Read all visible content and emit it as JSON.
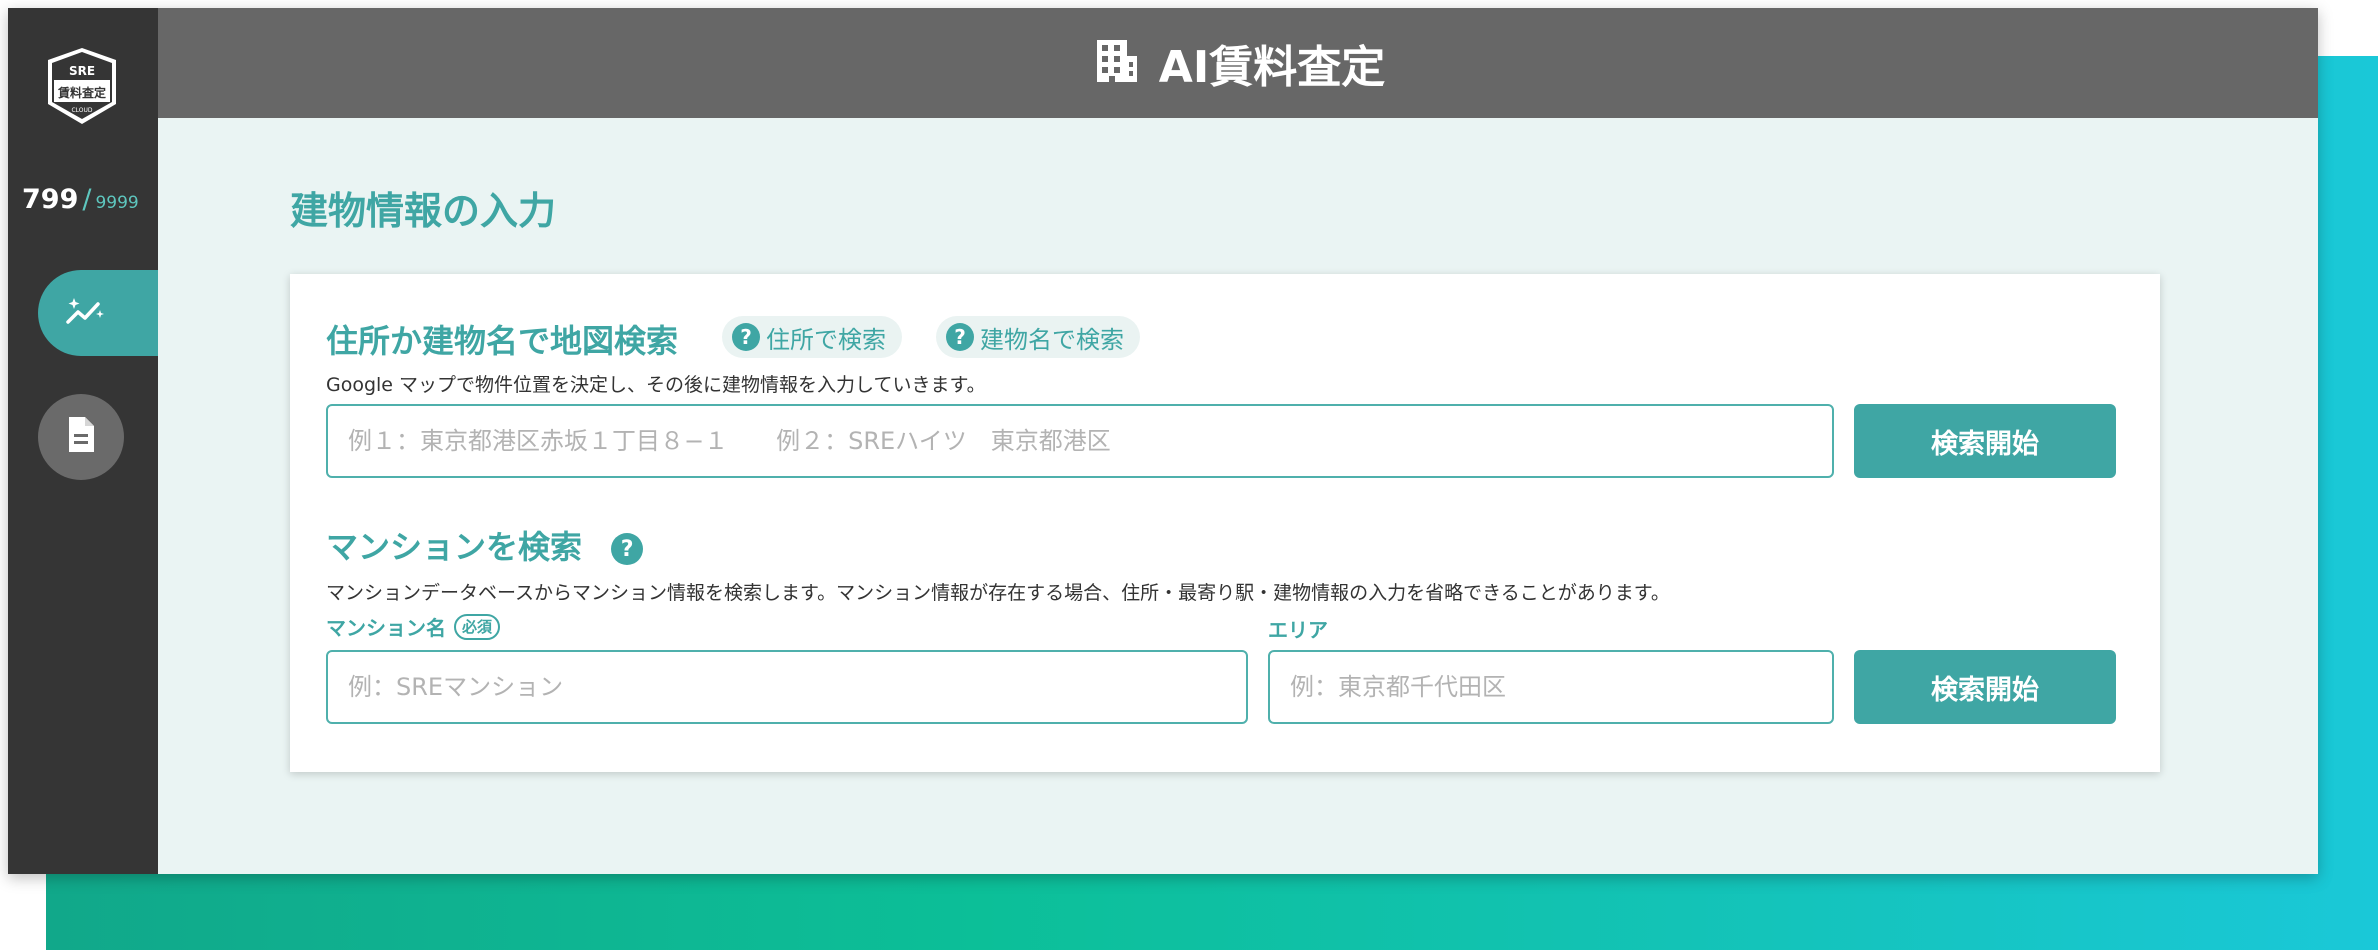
{
  "app": {
    "title": "AI賃料査定",
    "logo_text_top": "SRE",
    "logo_text_main": "賃料査定",
    "logo_text_sub": "CLOUD"
  },
  "sidebar": {
    "credits_used": "799",
    "credits_separator": "/",
    "credits_max": "9999",
    "items": [
      {
        "icon": "chart-sparkle-icon",
        "active": true
      },
      {
        "icon": "document-icon",
        "active": false
      }
    ]
  },
  "page": {
    "section_title": "建物情報の入力"
  },
  "map_search": {
    "heading": "住所か建物名で地図検索",
    "help_address": "住所で検索",
    "help_building": "建物名で検索",
    "description": "Google マップで物件位置を決定し、その後に建物情報を入力していきます。",
    "input_value": "",
    "input_placeholder": "例１：東京都港区赤坂１丁目８−１　　例２：SREハイツ　東京都港区",
    "button_label": "検索開始"
  },
  "mansion_search": {
    "heading": "マンションを検索",
    "description": "マンションデータベースからマンション情報を検索します。マンション情報が存在する場合、住所・最寄り駅・建物情報の入力を省略できることがあります。",
    "name_label": "マンション名",
    "required_badge": "必須",
    "name_placeholder": "例：SREマンション",
    "area_label": "エリア",
    "area_placeholder": "例：東京都千代田区",
    "button_label": "検索開始"
  },
  "colors": {
    "accent": "#3fa6a4",
    "sidebar": "#353535",
    "header": "#676767",
    "background": "#eaf4f3"
  }
}
